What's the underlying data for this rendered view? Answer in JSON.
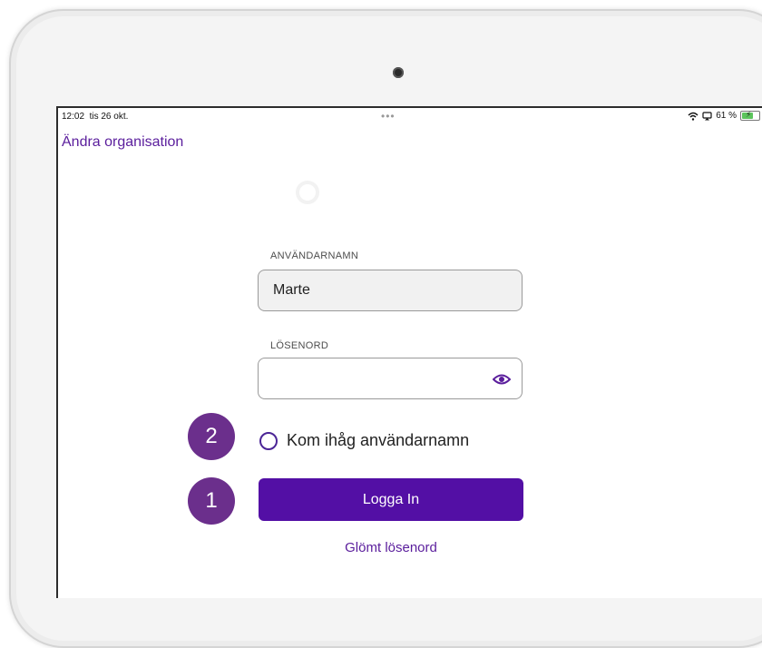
{
  "status_bar": {
    "time": "12:02",
    "date": "tis 26 okt.",
    "dots": "•••",
    "battery_percent": "61 %"
  },
  "header": {
    "change_org_label": "Ändra organisation"
  },
  "login_form": {
    "username_label": "ANVÄNDARNAMN",
    "username_value": "Marte",
    "password_label": "LÖSENORD",
    "password_value": "",
    "remember_label": "Kom ihåg användarnamn",
    "remember_checked": false,
    "login_button_label": "Logga In",
    "forgot_password_label": "Glömt lösenord"
  },
  "annotations": {
    "badge_remember": "2",
    "badge_login": "1"
  },
  "colors": {
    "accent": "#530fa5",
    "link": "#5a1d9c",
    "badge": "#6b2f8c"
  },
  "icons": [
    "wifi-icon",
    "screen-mirror-icon",
    "battery-icon",
    "eye-icon",
    "radio-icon",
    "camera-icon"
  ]
}
